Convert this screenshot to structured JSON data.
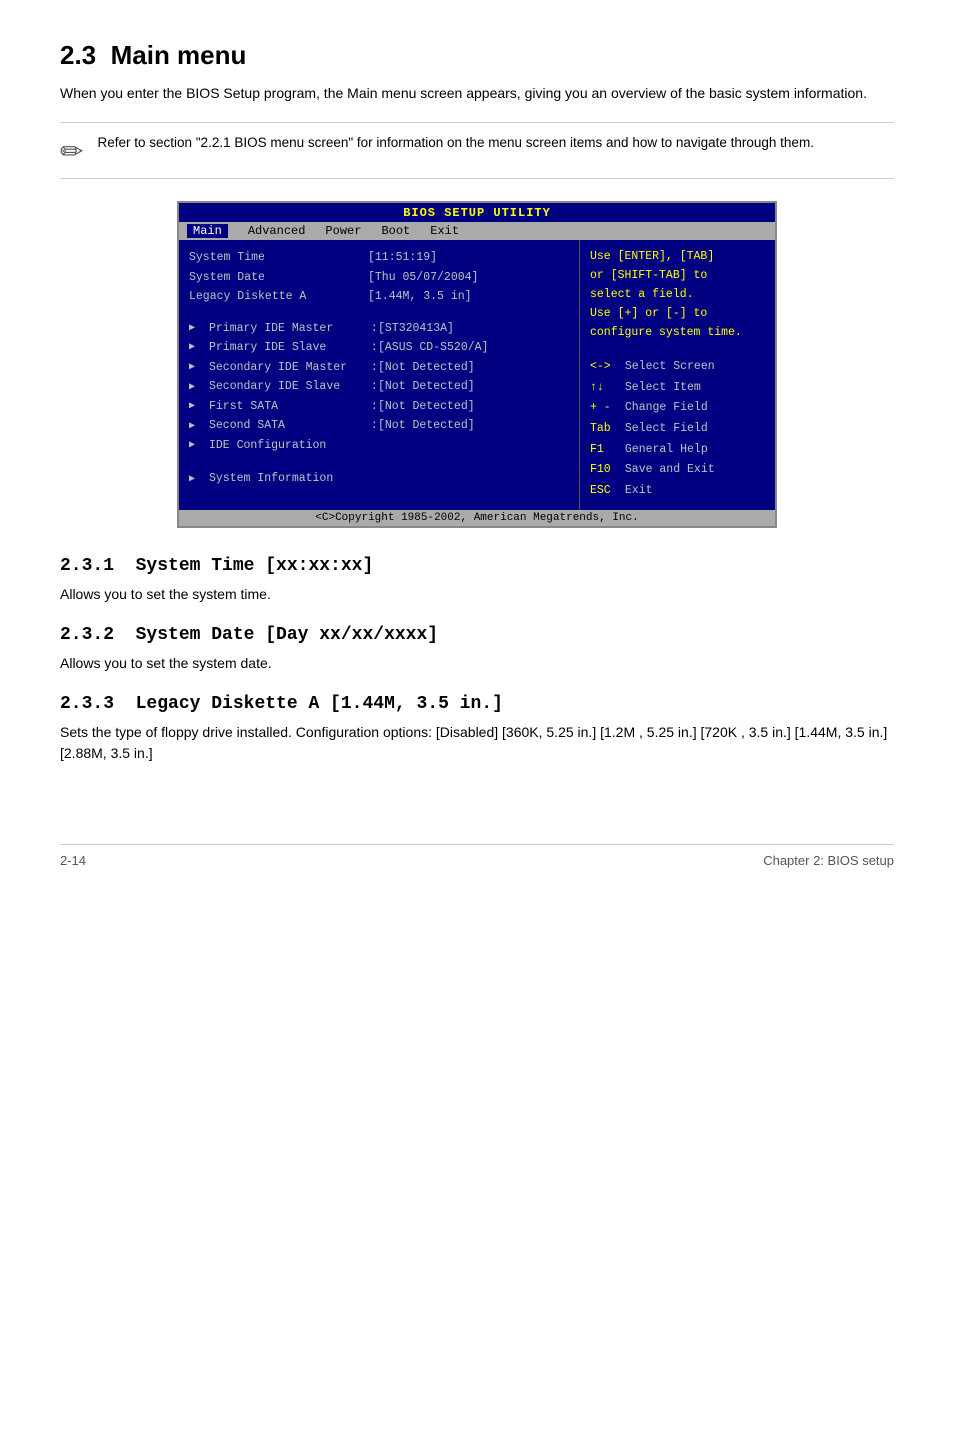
{
  "page": {
    "section_number": "2.3",
    "section_title": "Main menu",
    "intro": "When you enter the BIOS Setup program, the Main menu screen appears, giving you an overview of the basic system information.",
    "note": "Refer to section \"2.2.1  BIOS menu screen\" for information on the menu screen items and how to navigate through them.",
    "bios": {
      "header": "BIOS SETUP UTILITY",
      "menu_tabs": [
        "Main",
        "Advanced",
        "Power",
        "Boot",
        "Exit"
      ],
      "active_tab": "Main",
      "top_items": [
        {
          "label": "System Time",
          "value": "[11:51:19]"
        },
        {
          "label": "System Date",
          "value": "[Thu 05/07/2004]"
        },
        {
          "label": "Legacy Diskette A",
          "value": "[1.44M, 3.5 in]"
        }
      ],
      "sub_items": [
        {
          "label": "Primary IDE Master",
          "value": "[ST320413A]"
        },
        {
          "label": "Primary IDE Slave",
          "value": "[ASUS CD-S520/A]"
        },
        {
          "label": "Secondary IDE Master",
          "value": "[Not Detected]"
        },
        {
          "label": "Secondary IDE Slave",
          "value": "[Not Detected]"
        },
        {
          "label": "First SATA",
          "value": "[Not Detected]"
        },
        {
          "label": "Second SATA",
          "value": "[Not Detected]"
        },
        {
          "label": "IDE Configuration",
          "value": ""
        },
        {
          "label": "System Information",
          "value": ""
        }
      ],
      "help_top": "Use [ENTER], [TAB]\nor [SHIFT-TAB] to\nselect a field.\nUse [+] or [-] to\nconfigure system time.",
      "help_bottom": [
        {
          "key": "<->",
          "text": "Select Screen"
        },
        {
          "key": "↑↓",
          "text": "Select Item"
        },
        {
          "key": "+ -",
          "text": "Change Field"
        },
        {
          "key": "Tab",
          "text": "Select Field"
        },
        {
          "key": "F1",
          "text": "General Help"
        },
        {
          "key": "F10",
          "text": "Save and Exit"
        },
        {
          "key": "ESC",
          "text": "Exit"
        }
      ],
      "footer": "<C>Copyright 1985-2002, American Megatrends, Inc."
    },
    "subsections": [
      {
        "number": "2.3.1",
        "title": "System Time [xx:xx:xx]",
        "desc": "Allows you to set the system time."
      },
      {
        "number": "2.3.2",
        "title": "System Date [Day xx/xx/xxxx]",
        "desc": "Allows you to set the system date."
      },
      {
        "number": "2.3.3",
        "title": "Legacy Diskette A [1.44M, 3.5 in.]",
        "desc": "Sets the type of floppy drive installed. Configuration options: [Disabled] [360K, 5.25 in.] [1.2M , 5.25 in.] [720K , 3.5 in.] [1.44M, 3.5 in.] [2.88M, 3.5 in.]"
      }
    ],
    "footer": {
      "left": "2-14",
      "right": "Chapter 2: BIOS setup"
    }
  }
}
